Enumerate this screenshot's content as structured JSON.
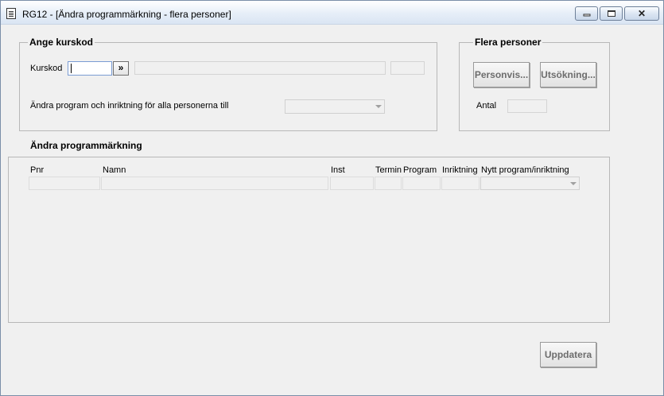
{
  "window": {
    "title": "RG12 - [Ändra programmärkning - flera personer]",
    "controls": [
      "minimize",
      "maximize",
      "close"
    ],
    "close_glyph": "✕"
  },
  "kurskod_group": {
    "legend": "Ange kurskod",
    "kurskod_label": "Kurskod",
    "kurskod_value": "",
    "lookup_button": "»",
    "change_all_label": "Ändra program och inriktning för alla personerna till",
    "change_all_value": ""
  },
  "flera_group": {
    "legend": "Flera personer",
    "personvis_button": "Personvis...",
    "utsokning_button": "Utsökning...",
    "antal_label": "Antal",
    "antal_value": ""
  },
  "table": {
    "title": "Ändra programmärkning",
    "columns": [
      "Pnr",
      "Namn",
      "Inst",
      "Termin",
      "Program",
      "Inriktning",
      "Nytt program/inriktning"
    ],
    "rows": []
  },
  "update_button": "Uppdatera",
  "colors": {
    "disabled_text": "#6d6d6d",
    "focus_border": "#7a9cd3"
  }
}
